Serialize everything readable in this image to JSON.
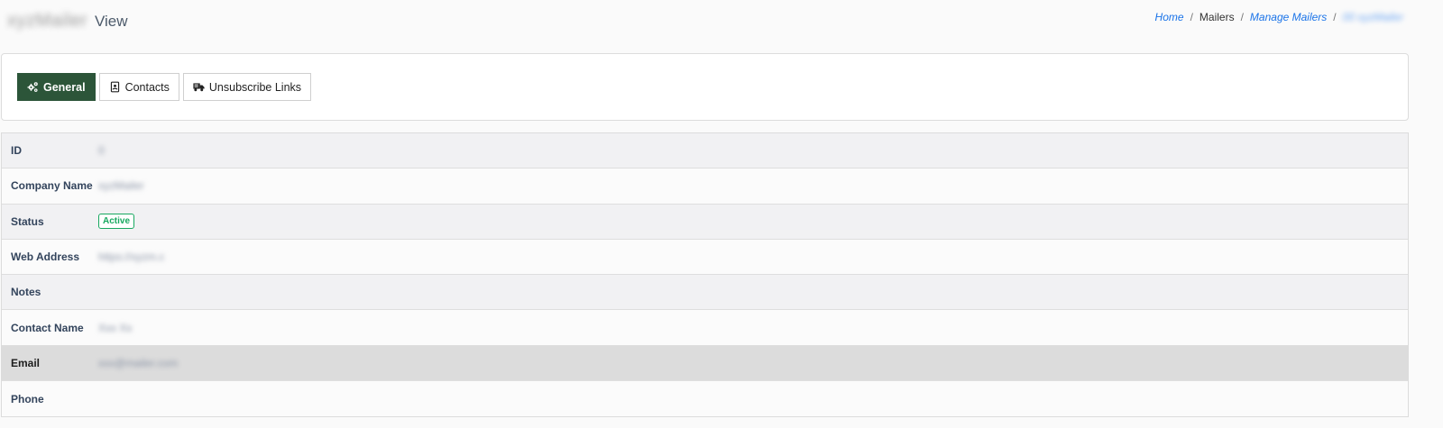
{
  "header": {
    "title_name": "xyzMailer",
    "title_suffix": "View"
  },
  "breadcrumb": {
    "home": "Home",
    "mailers": "Mailers",
    "manage": "Manage Mailers",
    "current": "00 xyzMailer",
    "separator": "/"
  },
  "tabs": {
    "general": {
      "label": "General",
      "icon": "gears-icon"
    },
    "contacts": {
      "label": "Contacts",
      "icon": "address-book-icon"
    },
    "unsubscribe": {
      "label": "Unsubscribe Links",
      "icon": "truck-icon"
    }
  },
  "details": {
    "id": {
      "label": "ID",
      "value": "0"
    },
    "company_name": {
      "label": "Company Name",
      "value": "xyzMailer"
    },
    "status": {
      "label": "Status",
      "value": "Active"
    },
    "web_address": {
      "label": "Web Address",
      "value": "https://xyzm.c"
    },
    "notes": {
      "label": "Notes",
      "value": ""
    },
    "contact_name": {
      "label": "Contact Name",
      "value": "Xxx Xx"
    },
    "email": {
      "label": "Email",
      "value": "xxx@mailer.com"
    },
    "phone": {
      "label": "Phone",
      "value": ""
    }
  },
  "colors": {
    "active_tab": "#2c5539",
    "link": "#1a73e8",
    "status_active": "#18a860"
  }
}
